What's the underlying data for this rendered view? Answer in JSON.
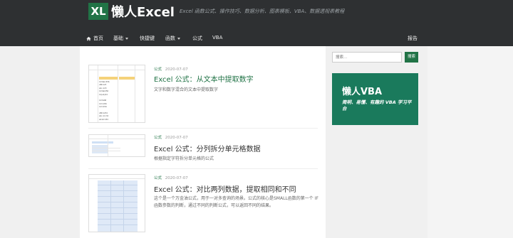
{
  "header": {
    "logo_badge": "XL",
    "logo_text": "懒人Excel",
    "tagline": "Excel 函数公式、操作技巧、数据分析、图表模板、VBA、数据透视表教程"
  },
  "nav": {
    "items": [
      {
        "label": "首页",
        "icon": "home-icon"
      },
      {
        "label": "基础",
        "dropdown": true
      },
      {
        "label": "快捷键"
      },
      {
        "label": "函数",
        "dropdown": true
      },
      {
        "label": "公式"
      },
      {
        "label": "VBA"
      }
    ],
    "right_label": "报告"
  },
  "posts": [
    {
      "category": "公式",
      "date": "2020-07-07",
      "title": "Excel 公式：从文本中提取数字",
      "excerpt": "文字和数字混合的文本中提取数字"
    },
    {
      "category": "公式",
      "date": "2020-07-07",
      "title": "Excel 公式：分列拆分单元格数据",
      "excerpt": "根据指定字符拆分单元格的公式"
    },
    {
      "category": "公式",
      "date": "2020-07-07",
      "title": "Excel 公式：对比两列数据，提取相同和不同",
      "excerpt": "这个是一个万金油公式，用于一对多查询的场景。公式的核心是SMALL函数的第一个 IF函数参数的判断，通过不同的判断公式，可以返回不同的结果。"
    }
  ],
  "thumb1": {
    "rows": [
      "123abc456",
      "ABC123",
      "abc-123",
      "123ab456",
      "12(ab)34",
      "",
      "1234AB",
      "123-456",
      "123.456",
      "",
      "ABC1234",
      "abc-12-34",
      "ab12cd34"
    ]
  },
  "sidebar": {
    "search_placeholder": "搜索...",
    "search_button": "搜索",
    "promo_title": "懒人VBA",
    "promo_subtitle": "简明、易懂、有趣的 VBA 学习平台"
  },
  "colors": {
    "header_bg": "#2e3032",
    "accent": "#217346",
    "promo_bg": "#1a7a5c"
  }
}
